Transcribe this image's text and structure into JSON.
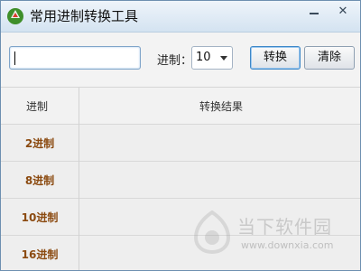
{
  "window": {
    "title": "常用进制转换工具",
    "app_icon": "green-recycle-icon",
    "controls": {
      "minimize": "minimize-icon",
      "close": "close-icon",
      "close_glyph": "✕"
    }
  },
  "toolbar": {
    "input_value": "",
    "base_label": "进制：",
    "base_value": "10",
    "convert_label": "转换",
    "clear_label": "清除"
  },
  "table": {
    "headers": {
      "base": "进制",
      "result": "转换结果"
    },
    "rows": [
      {
        "label": "2进制",
        "result": ""
      },
      {
        "label": "8进制",
        "result": ""
      },
      {
        "label": "10进制",
        "result": ""
      },
      {
        "label": "16进制",
        "result": ""
      }
    ]
  },
  "watermark": {
    "title": "当下软件园",
    "url": "www.downxia.com"
  }
}
